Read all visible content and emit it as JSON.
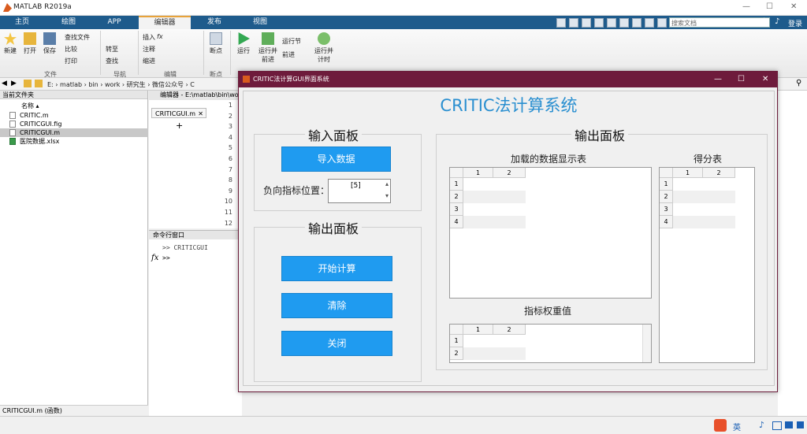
{
  "app": {
    "title": "MATLAB R2019a"
  },
  "tabs": [
    {
      "label": "主页"
    },
    {
      "label": "绘图"
    },
    {
      "label": "APP"
    },
    {
      "label": "编辑器"
    },
    {
      "label": "发布"
    },
    {
      "label": "视图"
    }
  ],
  "search": {
    "placeholder": "搜索文档"
  },
  "login": "登录",
  "ribbon": {
    "file": {
      "new": "新建",
      "open": "打开",
      "save": "保存",
      "find_file": "查找文件",
      "compare": "比较",
      "print": "打印",
      "section": "文件"
    },
    "nav": {
      "goto": "转至",
      "find": "查找",
      "section": "导航"
    },
    "edit": {
      "insert": "插入",
      "comment": "注释",
      "indent": "缩进",
      "section": "编辑"
    },
    "breakpoints": {
      "label": "断点",
      "section": "断点"
    },
    "run": {
      "run": "运行",
      "run_advance": "运行并前进",
      "run_section": "运行节",
      "advance": "前进",
      "run_time": "运行并计时",
      "section": "运行"
    }
  },
  "address": {
    "path": "E: › matlab › bin › work › 研究生 › 微信公众号 › C"
  },
  "files": {
    "header": "当前文件夹",
    "col": "名称 ▴",
    "items": [
      {
        "name": "CRITIC.m"
      },
      {
        "name": "CRITICGUI.fig"
      },
      {
        "name": "CRITICGUI.m"
      },
      {
        "name": "医院数据.xlsx"
      }
    ],
    "status": "CRITICGUI.m (函数)"
  },
  "editor": {
    "header": "编辑器 - E:\\matlab\\bin\\wo",
    "tab": "CRITICGUI.m",
    "lines": [
      "1",
      "2",
      "3",
      "4",
      "5",
      "6",
      "7",
      "8",
      "9",
      "10",
      "11",
      "12"
    ]
  },
  "command": {
    "header": "命令行窗口",
    "line1": ">>  CRITICGUI",
    "prompt": ">>",
    "fx": "fx"
  },
  "gui": {
    "window_title": "CRITIC法计算GUI界面系统",
    "main_title": "CRITIC法计算系统",
    "input_panel": {
      "title": "输入面板",
      "import_button": "导入数据",
      "neg_label": "负向指标位置：",
      "neg_value": "[5]"
    },
    "control_panel": {
      "title": "输出面板",
      "start_button": "开始计算",
      "clear_button": "清除",
      "close_button": "关闭"
    },
    "output_panel": {
      "title": "输出面板",
      "data_table": {
        "title": "加载的数据显示表",
        "cols": [
          "1",
          "2"
        ],
        "rows": [
          "1",
          "2",
          "3",
          "4"
        ]
      },
      "score_table": {
        "title": "得分表",
        "cols": [
          "1",
          "2"
        ],
        "rows": [
          "1",
          "2",
          "3",
          "4"
        ]
      },
      "weight_table": {
        "title": "指标权重值",
        "cols": [
          "1",
          "2"
        ],
        "rows": [
          "1",
          "2"
        ]
      }
    }
  },
  "taskbar": {
    "ime": "英"
  }
}
